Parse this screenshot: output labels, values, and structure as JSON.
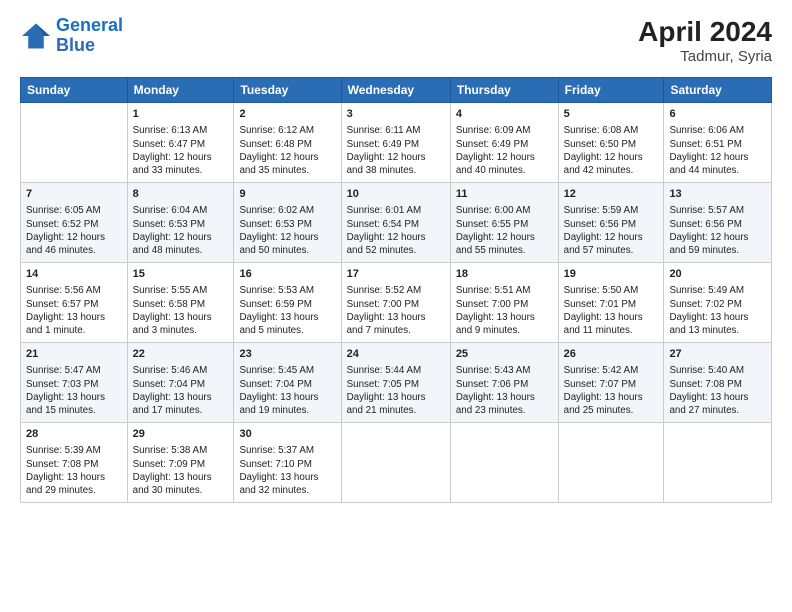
{
  "header": {
    "logo_line1": "General",
    "logo_line2": "Blue",
    "title": "April 2024",
    "subtitle": "Tadmur, Syria"
  },
  "days_of_week": [
    "Sunday",
    "Monday",
    "Tuesday",
    "Wednesday",
    "Thursday",
    "Friday",
    "Saturday"
  ],
  "weeks": [
    [
      {
        "num": "",
        "text": ""
      },
      {
        "num": "1",
        "text": "Sunrise: 6:13 AM\nSunset: 6:47 PM\nDaylight: 12 hours\nand 33 minutes."
      },
      {
        "num": "2",
        "text": "Sunrise: 6:12 AM\nSunset: 6:48 PM\nDaylight: 12 hours\nand 35 minutes."
      },
      {
        "num": "3",
        "text": "Sunrise: 6:11 AM\nSunset: 6:49 PM\nDaylight: 12 hours\nand 38 minutes."
      },
      {
        "num": "4",
        "text": "Sunrise: 6:09 AM\nSunset: 6:49 PM\nDaylight: 12 hours\nand 40 minutes."
      },
      {
        "num": "5",
        "text": "Sunrise: 6:08 AM\nSunset: 6:50 PM\nDaylight: 12 hours\nand 42 minutes."
      },
      {
        "num": "6",
        "text": "Sunrise: 6:06 AM\nSunset: 6:51 PM\nDaylight: 12 hours\nand 44 minutes."
      }
    ],
    [
      {
        "num": "7",
        "text": "Sunrise: 6:05 AM\nSunset: 6:52 PM\nDaylight: 12 hours\nand 46 minutes."
      },
      {
        "num": "8",
        "text": "Sunrise: 6:04 AM\nSunset: 6:53 PM\nDaylight: 12 hours\nand 48 minutes."
      },
      {
        "num": "9",
        "text": "Sunrise: 6:02 AM\nSunset: 6:53 PM\nDaylight: 12 hours\nand 50 minutes."
      },
      {
        "num": "10",
        "text": "Sunrise: 6:01 AM\nSunset: 6:54 PM\nDaylight: 12 hours\nand 52 minutes."
      },
      {
        "num": "11",
        "text": "Sunrise: 6:00 AM\nSunset: 6:55 PM\nDaylight: 12 hours\nand 55 minutes."
      },
      {
        "num": "12",
        "text": "Sunrise: 5:59 AM\nSunset: 6:56 PM\nDaylight: 12 hours\nand 57 minutes."
      },
      {
        "num": "13",
        "text": "Sunrise: 5:57 AM\nSunset: 6:56 PM\nDaylight: 12 hours\nand 59 minutes."
      }
    ],
    [
      {
        "num": "14",
        "text": "Sunrise: 5:56 AM\nSunset: 6:57 PM\nDaylight: 13 hours\nand 1 minute."
      },
      {
        "num": "15",
        "text": "Sunrise: 5:55 AM\nSunset: 6:58 PM\nDaylight: 13 hours\nand 3 minutes."
      },
      {
        "num": "16",
        "text": "Sunrise: 5:53 AM\nSunset: 6:59 PM\nDaylight: 13 hours\nand 5 minutes."
      },
      {
        "num": "17",
        "text": "Sunrise: 5:52 AM\nSunset: 7:00 PM\nDaylight: 13 hours\nand 7 minutes."
      },
      {
        "num": "18",
        "text": "Sunrise: 5:51 AM\nSunset: 7:00 PM\nDaylight: 13 hours\nand 9 minutes."
      },
      {
        "num": "19",
        "text": "Sunrise: 5:50 AM\nSunset: 7:01 PM\nDaylight: 13 hours\nand 11 minutes."
      },
      {
        "num": "20",
        "text": "Sunrise: 5:49 AM\nSunset: 7:02 PM\nDaylight: 13 hours\nand 13 minutes."
      }
    ],
    [
      {
        "num": "21",
        "text": "Sunrise: 5:47 AM\nSunset: 7:03 PM\nDaylight: 13 hours\nand 15 minutes."
      },
      {
        "num": "22",
        "text": "Sunrise: 5:46 AM\nSunset: 7:04 PM\nDaylight: 13 hours\nand 17 minutes."
      },
      {
        "num": "23",
        "text": "Sunrise: 5:45 AM\nSunset: 7:04 PM\nDaylight: 13 hours\nand 19 minutes."
      },
      {
        "num": "24",
        "text": "Sunrise: 5:44 AM\nSunset: 7:05 PM\nDaylight: 13 hours\nand 21 minutes."
      },
      {
        "num": "25",
        "text": "Sunrise: 5:43 AM\nSunset: 7:06 PM\nDaylight: 13 hours\nand 23 minutes."
      },
      {
        "num": "26",
        "text": "Sunrise: 5:42 AM\nSunset: 7:07 PM\nDaylight: 13 hours\nand 25 minutes."
      },
      {
        "num": "27",
        "text": "Sunrise: 5:40 AM\nSunset: 7:08 PM\nDaylight: 13 hours\nand 27 minutes."
      }
    ],
    [
      {
        "num": "28",
        "text": "Sunrise: 5:39 AM\nSunset: 7:08 PM\nDaylight: 13 hours\nand 29 minutes."
      },
      {
        "num": "29",
        "text": "Sunrise: 5:38 AM\nSunset: 7:09 PM\nDaylight: 13 hours\nand 30 minutes."
      },
      {
        "num": "30",
        "text": "Sunrise: 5:37 AM\nSunset: 7:10 PM\nDaylight: 13 hours\nand 32 minutes."
      },
      {
        "num": "",
        "text": ""
      },
      {
        "num": "",
        "text": ""
      },
      {
        "num": "",
        "text": ""
      },
      {
        "num": "",
        "text": ""
      }
    ]
  ]
}
